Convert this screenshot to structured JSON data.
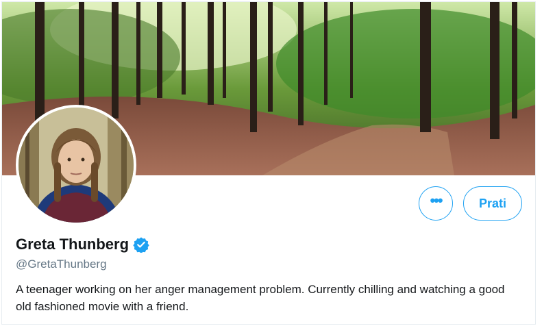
{
  "profile": {
    "display_name": "Greta Thunberg",
    "handle": "@GretaThunberg",
    "verified": true,
    "bio": "A teenager working on her anger management problem. Currently chilling and watching a good old fashioned movie with a friend."
  },
  "actions": {
    "more_label": "•••",
    "follow_label": "Prati"
  },
  "icons": {
    "more": "more-icon",
    "verified": "verified-badge-icon"
  },
  "colors": {
    "accent": "#1da1f2",
    "name_text": "#14171a",
    "secondary_text": "#657786"
  }
}
